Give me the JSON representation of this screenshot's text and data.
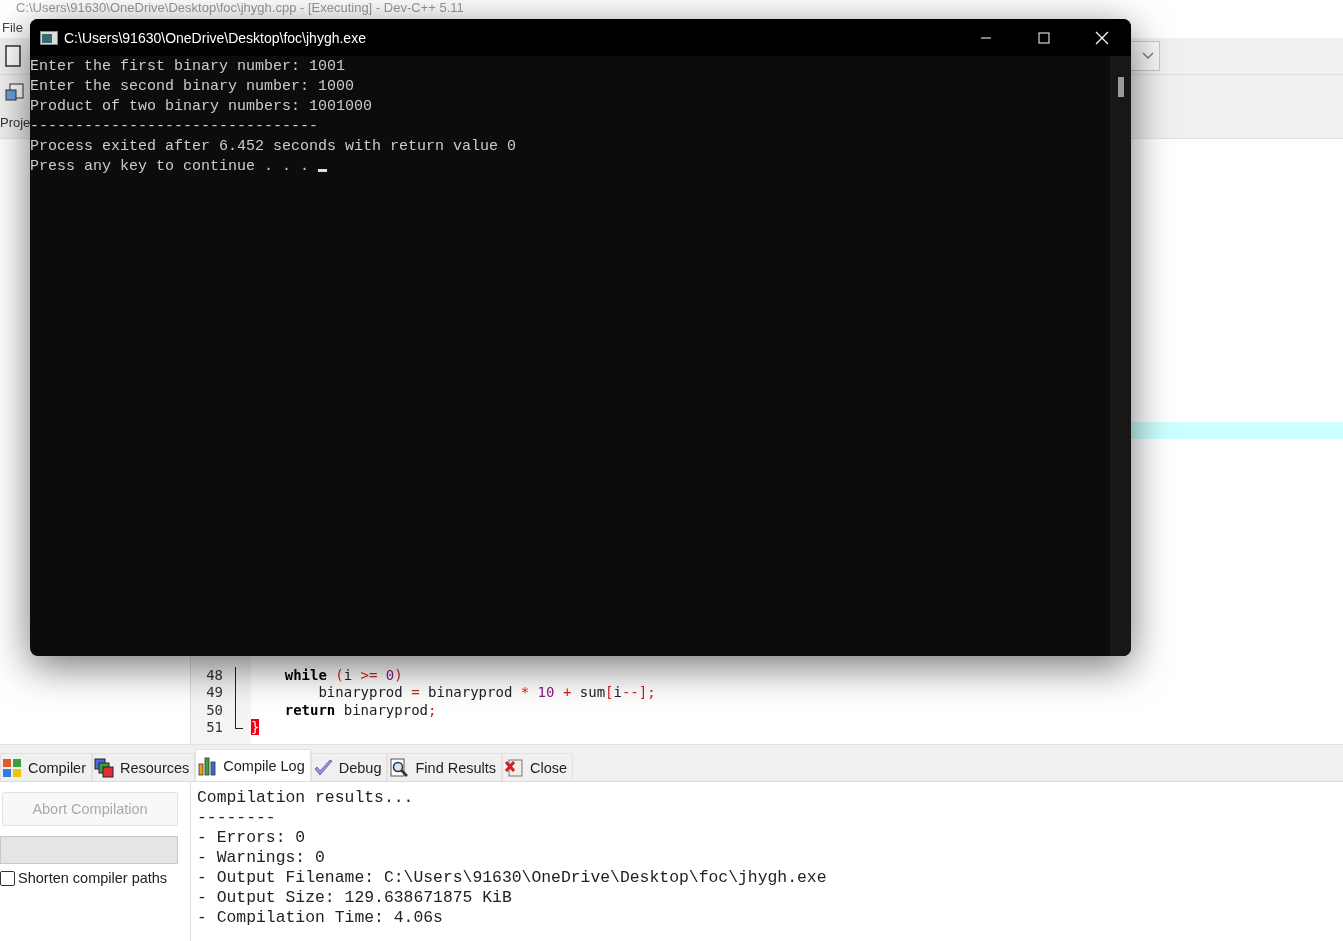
{
  "ide": {
    "title": "C:\\Users\\91630\\OneDrive\\Desktop\\foc\\jhygh.cpp - [Executing] - Dev-C++ 5.11",
    "menu": [
      "File"
    ],
    "project_tab": "Proje",
    "editor": {
      "lines": [
        {
          "number": "48",
          "tokens": [
            {
              "text": "    while",
              "kind": "keyword"
            },
            {
              "text": " (",
              "kind": "symbol"
            },
            {
              "text": "i ",
              "kind": "plain"
            },
            {
              "text": ">=",
              "kind": "symbol"
            },
            {
              "text": " 0",
              "kind": "number"
            },
            {
              "text": ")",
              "kind": "symbol"
            }
          ]
        },
        {
          "number": "49",
          "tokens": [
            {
              "text": "        binaryprod ",
              "kind": "plain"
            },
            {
              "text": "=",
              "kind": "symbol"
            },
            {
              "text": " binaryprod ",
              "kind": "plain"
            },
            {
              "text": "*",
              "kind": "symbol"
            },
            {
              "text": " 10",
              "kind": "number"
            },
            {
              "text": " +",
              "kind": "symbol"
            },
            {
              "text": " sum",
              "kind": "plain"
            },
            {
              "text": "[",
              "kind": "symbol"
            },
            {
              "text": "i",
              "kind": "plain"
            },
            {
              "text": "--];",
              "kind": "symbol"
            }
          ]
        },
        {
          "number": "50",
          "tokens": [
            {
              "text": "    return",
              "kind": "keyword"
            },
            {
              "text": " binaryprod",
              "kind": "plain"
            },
            {
              "text": ";",
              "kind": "symbol"
            }
          ]
        },
        {
          "number": "51",
          "tokens": [
            {
              "text": "}",
              "kind": "brace_match"
            }
          ]
        }
      ]
    },
    "bottom_tabs": [
      {
        "label": "Compiler",
        "selected": false
      },
      {
        "label": "Resources",
        "selected": false
      },
      {
        "label": "Compile Log",
        "selected": true
      },
      {
        "label": "Debug",
        "selected": false
      },
      {
        "label": "Find Results",
        "selected": false
      },
      {
        "label": "Close",
        "selected": false
      }
    ],
    "abort_button": {
      "label": "Abort Compilation",
      "disabled": true
    },
    "progress": {
      "level": 0
    },
    "shorten_paths": {
      "label": "Shorten compiler paths",
      "checked": false
    },
    "log": [
      "Compilation results...",
      "--------",
      "- Errors: 0",
      "- Warnings: 0",
      "- Output Filename: C:\\Users\\91630\\OneDrive\\Desktop\\foc\\jhygh.exe",
      "- Output Size: 129.638671875 KiB",
      "- Compilation Time: 4.06s"
    ]
  },
  "console": {
    "title": "C:\\Users\\91630\\OneDrive\\Desktop\\foc\\jhygh.exe",
    "lines": [
      "Enter the first binary number: 1001",
      "Enter the second binary number: 1000",
      "Product of two binary numbers: 1001000",
      "--------------------------------",
      "Process exited after 6.452 seconds with return value 0",
      "Press any key to continue . . . "
    ],
    "cursor": true
  }
}
